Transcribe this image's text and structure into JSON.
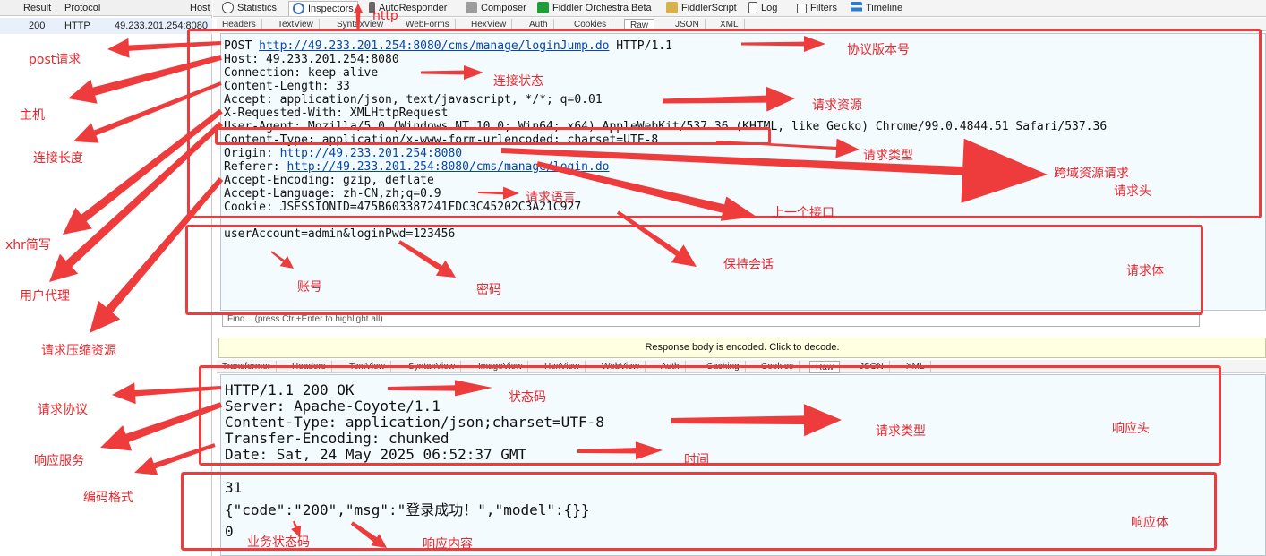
{
  "session_list": {
    "columns": [
      "Result",
      "Protocol",
      "Host"
    ],
    "row": {
      "result": "200",
      "protocol": "HTTP",
      "host": "49.233.201.254:8080"
    }
  },
  "top_tabs": [
    "Statistics",
    "Inspectors",
    "AutoResponder",
    "Composer",
    "Fiddler Orchestra Beta",
    "FiddlerScript",
    "Log",
    "Filters",
    "Timeline"
  ],
  "request_tabs": [
    "Headers",
    "TextView",
    "SyntaxView",
    "WebForms",
    "HexView",
    "Auth",
    "Cookies",
    "Raw",
    "JSON",
    "XML"
  ],
  "request": {
    "method": "POST ",
    "url": "http://49.233.201.254:8080/cms/manage/loginJump.do",
    "version": " HTTP/1.1",
    "host": "Host: 49.233.201.254:8080",
    "connection": "Connection: keep-alive",
    "content_length": "Content-Length: 33",
    "accept": "Accept: application/json, text/javascript, */*; q=0.01",
    "x_requested_with": "X-Requested-With: XMLHttpRequest",
    "user_agent": "User-Agent: Mozilla/5.0 (Windows NT 10.0; Win64; x64) AppleWebKit/537.36 (KHTML, like Gecko) Chrome/99.0.4844.51 Safari/537.36",
    "content_type": "Content-Type: application/x-www-form-urlencoded; charset=UTF-8",
    "origin_label": "Origin: ",
    "origin_url": "http://49.233.201.254:8080",
    "referer_label": "Referer: ",
    "referer_url": "http://49.233.201.254:8080/cms/manage/login.do",
    "accept_encoding": "Accept-Encoding: gzip, deflate",
    "accept_language": "Accept-Language: zh-CN,zh;q=0.9",
    "cookie": "Cookie: JSESSIONID=475B603387241FDC3C45202C3A21C927",
    "body": "userAccount=admin&loginPwd=123456"
  },
  "find_placeholder": "Find... (press Ctrl+Enter to highlight all)",
  "decode_notice": "Response body is encoded. Click to decode.",
  "response_tabs": [
    "Transformer",
    "Headers",
    "TextView",
    "SyntaxView",
    "ImageView",
    "HexView",
    "WebView",
    "Auth",
    "Caching",
    "Cookies",
    "Raw",
    "JSON",
    "XML"
  ],
  "response": {
    "status_line": "HTTP/1.1 200 OK",
    "server": "Server: Apache-Coyote/1.1",
    "content_type": "Content-Type: application/json;charset=UTF-8",
    "transfer_encoding": "Transfer-Encoding: chunked",
    "date": "Date: Sat, 24 May 2025 06:52:37 GMT",
    "chunk_size": "31",
    "body": "{\"code\":\"200\",\"msg\":\"登录成功！\",\"model\":{}}",
    "chunk_end": "0"
  },
  "annotations": {
    "http": "http",
    "post_request": "post请求",
    "host": "主机",
    "content_length": "连接长度",
    "xhr": "xhr简写",
    "user_agent": "用户代理",
    "accept_encoding": "请求压缩资源",
    "protocol_version": "协议版本号",
    "connection_state": "连接状态",
    "request_resource": "请求资源",
    "request_type": "请求类型",
    "cors": "跨域资源请求",
    "request_headers": "请求头",
    "request_language": "请求语言",
    "previous_api": "上一个接口",
    "keep_session": "保持会话",
    "account": "账号",
    "password": "密码",
    "request_body": "请求体",
    "request_protocol": "请求协议",
    "response_server": "响应服务",
    "encoding_format": "编码格式",
    "status_code": "状态码",
    "response_type": "请求类型",
    "time": "时间",
    "response_headers": "响应头",
    "business_status_code": "业务状态码",
    "response_content": "响应内容",
    "response_body": "响应体"
  },
  "colors": {
    "annotation_red": "#ee3b3b",
    "pane_bg": "#f3fbff",
    "link": "#0645ad"
  }
}
